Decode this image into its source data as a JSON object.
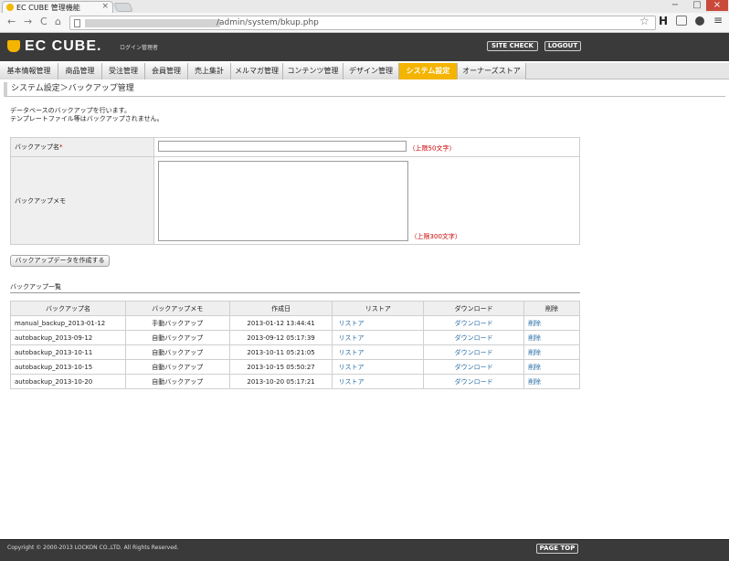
{
  "browser": {
    "tab_title": "EC CUBE 管理機能",
    "tab_close": "×",
    "url": "/admin/system/bkup.php",
    "window_controls": {
      "minimize": "−",
      "maximize": "□",
      "close": "×"
    },
    "nav": {
      "back": "←",
      "forward": "→",
      "reload": "C",
      "home": "⌂"
    },
    "icons": {
      "star": "☆",
      "extension_h": "H",
      "menu": "≡"
    }
  },
  "header": {
    "logo": "EC CUBE.",
    "subtitle": "ログイン管理者",
    "site_check": "SITE CHECK",
    "logout": "LOGOUT"
  },
  "main_nav": [
    {
      "label": "基本情報管理",
      "active": false
    },
    {
      "label": "商品管理",
      "active": false
    },
    {
      "label": "受注管理",
      "active": false
    },
    {
      "label": "会員管理",
      "active": false
    },
    {
      "label": "売上集計",
      "active": false
    },
    {
      "label": "メルマガ管理",
      "active": false
    },
    {
      "label": "コンテンツ管理",
      "active": false
    },
    {
      "label": "デザイン管理",
      "active": false
    },
    {
      "label": "システム設定",
      "active": true
    },
    {
      "label": "オーナーズストア",
      "active": false
    }
  ],
  "breadcrumb": "システム設定＞バックアップ管理",
  "description": {
    "line1": "データベースのバックアップを行います。",
    "line2": "テンプレートファイル等はバックアップされません。"
  },
  "form": {
    "name_label": "バックアップ名",
    "required_mark": "*",
    "name_value": "",
    "name_limit": "（上限50文字）",
    "memo_label": "バックアップメモ",
    "memo_value": "",
    "memo_limit": "（上限300文字）",
    "create_button": "バックアップデータを作成する"
  },
  "list": {
    "title": "バックアップ一覧",
    "headers": [
      "バックアップ名",
      "バックアップメモ",
      "作成日",
      "リストア",
      "ダウンロード",
      "削除"
    ],
    "rows": [
      [
        "manual_backup_2013-01-12",
        "手動バックアップ",
        "2013-01-12 13:44:41",
        "リストア",
        "ダウンロード",
        "削除"
      ],
      [
        "autobackup_2013-09-12",
        "自動バックアップ",
        "2013-09-12 05:17:39",
        "リストア",
        "ダウンロード",
        "削除"
      ],
      [
        "autobackup_2013-10-11",
        "自動バックアップ",
        "2013-10-11 05:21:05",
        "リストア",
        "ダウンロード",
        "削除"
      ],
      [
        "autobackup_2013-10-15",
        "自動バックアップ",
        "2013-10-15 05:50:27",
        "リストア",
        "ダウンロード",
        "削除"
      ],
      [
        "autobackup_2013-10-20",
        "自動バックアップ",
        "2013-10-20 05:17:21",
        "リストア",
        "ダウンロード",
        "削除"
      ]
    ]
  },
  "footer": {
    "copyright": "Copyright © 2000-2013 LOCKON CO.,LTD. All Rights Reserved.",
    "page_top": "PAGE TOP"
  },
  "colors": {
    "accent": "#f4b400",
    "header_bg": "#3a3a3a",
    "link": "#2a6ea6",
    "required": "#cc0000"
  }
}
